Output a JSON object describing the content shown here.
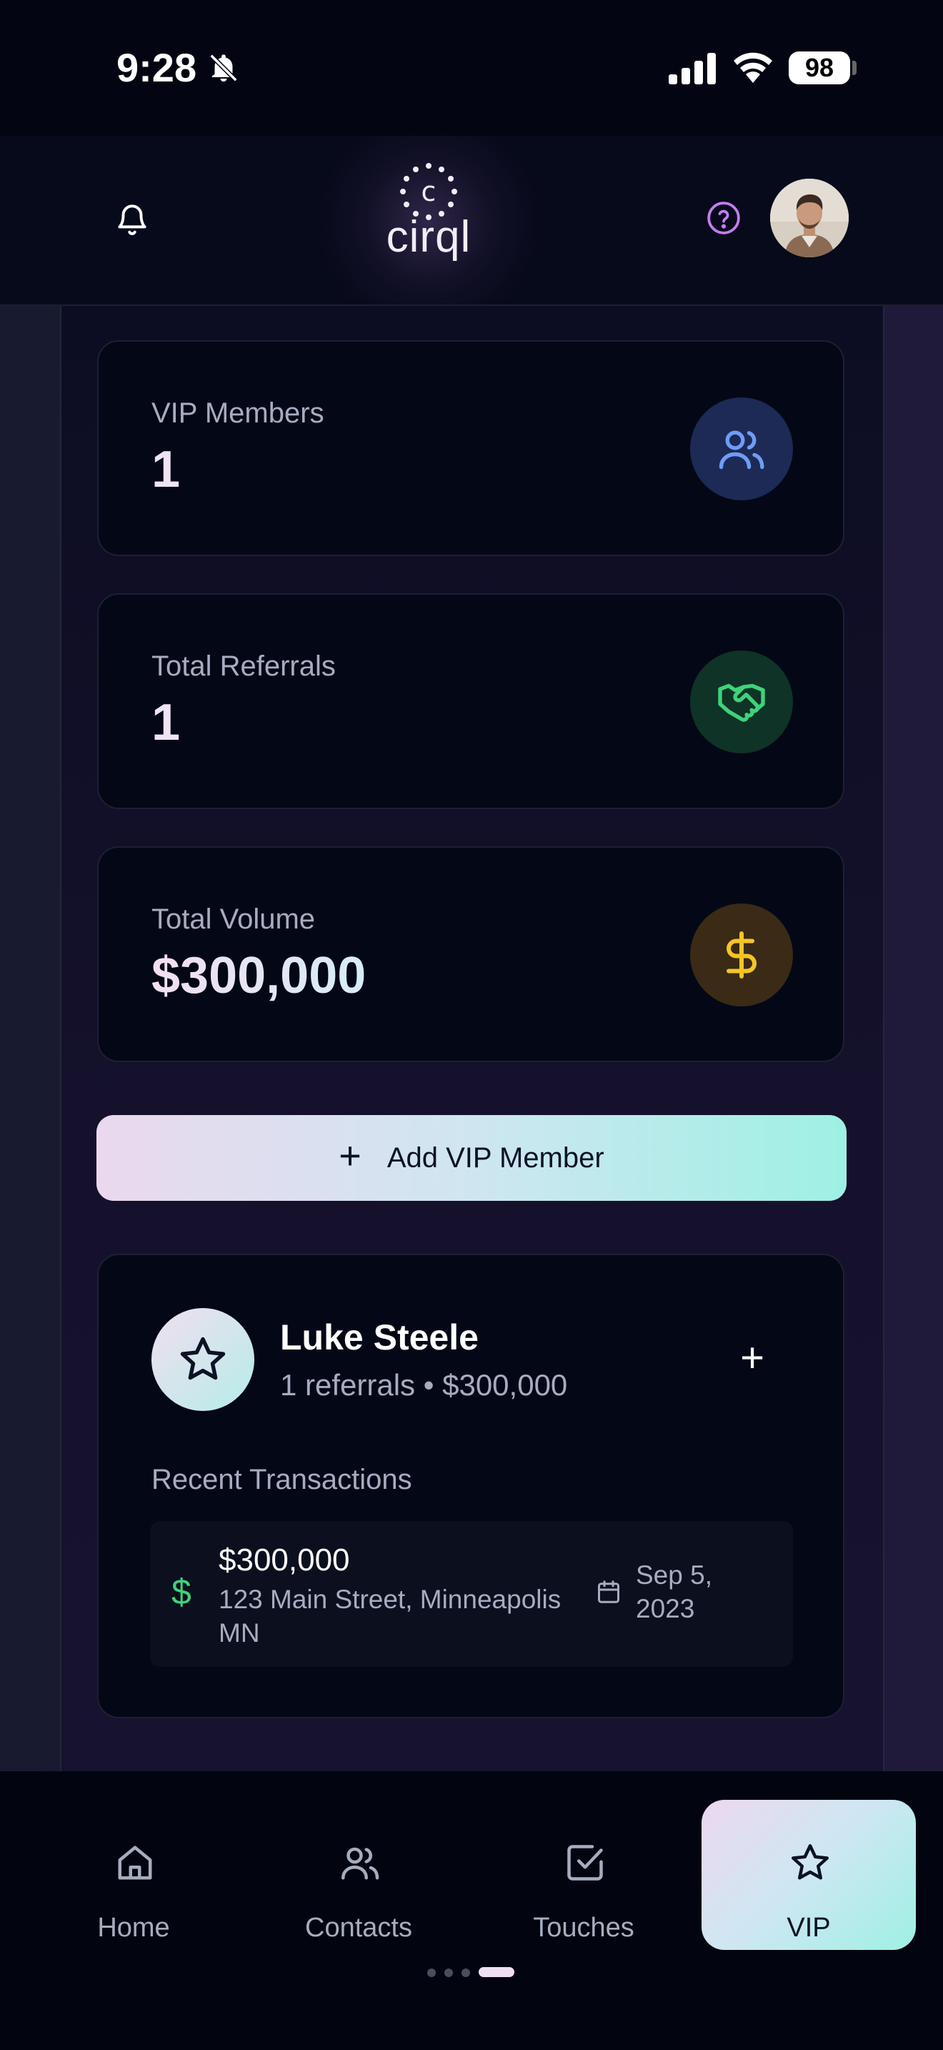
{
  "status_bar": {
    "time": "9:28",
    "battery": "98"
  },
  "header": {
    "logo_letter": "c",
    "logo_text": "cirql"
  },
  "stats": [
    {
      "label": "VIP Members",
      "value": "1",
      "icon": "users-icon",
      "icon_color": "#6f9cf7",
      "icon_bg": "#1d2a55"
    },
    {
      "label": "Total Referrals",
      "value": "1",
      "icon": "handshake-icon",
      "icon_color": "#3fd27a",
      "icon_bg": "#0f3326"
    },
    {
      "label": "Total Volume",
      "value": "$300,000",
      "icon": "dollar-icon",
      "icon_color": "#f5c524",
      "icon_bg": "#3a2a16"
    }
  ],
  "add_vip_button": {
    "icon": "+",
    "label": "Add VIP Member"
  },
  "member": {
    "name": "Luke Steele",
    "summary": "1 referrals • $300,000",
    "add_icon": "+",
    "recent_label": "Recent Transactions",
    "transactions": [
      {
        "currency_icon": "$",
        "amount": "$300,000",
        "address": "123 Main Street, Minneapolis MN",
        "date": "Sep 5, 2023"
      }
    ]
  },
  "tabs": [
    {
      "label": "Home",
      "icon": "home-icon",
      "active": false
    },
    {
      "label": "Contacts",
      "icon": "contacts-icon",
      "active": false
    },
    {
      "label": "Touches",
      "icon": "checkbox-icon",
      "active": false
    },
    {
      "label": "VIP",
      "icon": "star-icon",
      "active": true
    }
  ],
  "colors": {
    "background": "#040714",
    "card": "#040816",
    "accent_gradient_start": "#ecd8ef",
    "accent_gradient_end": "#9ef0e4",
    "success": "#3fd27a",
    "help_icon": "#c57cf0"
  }
}
